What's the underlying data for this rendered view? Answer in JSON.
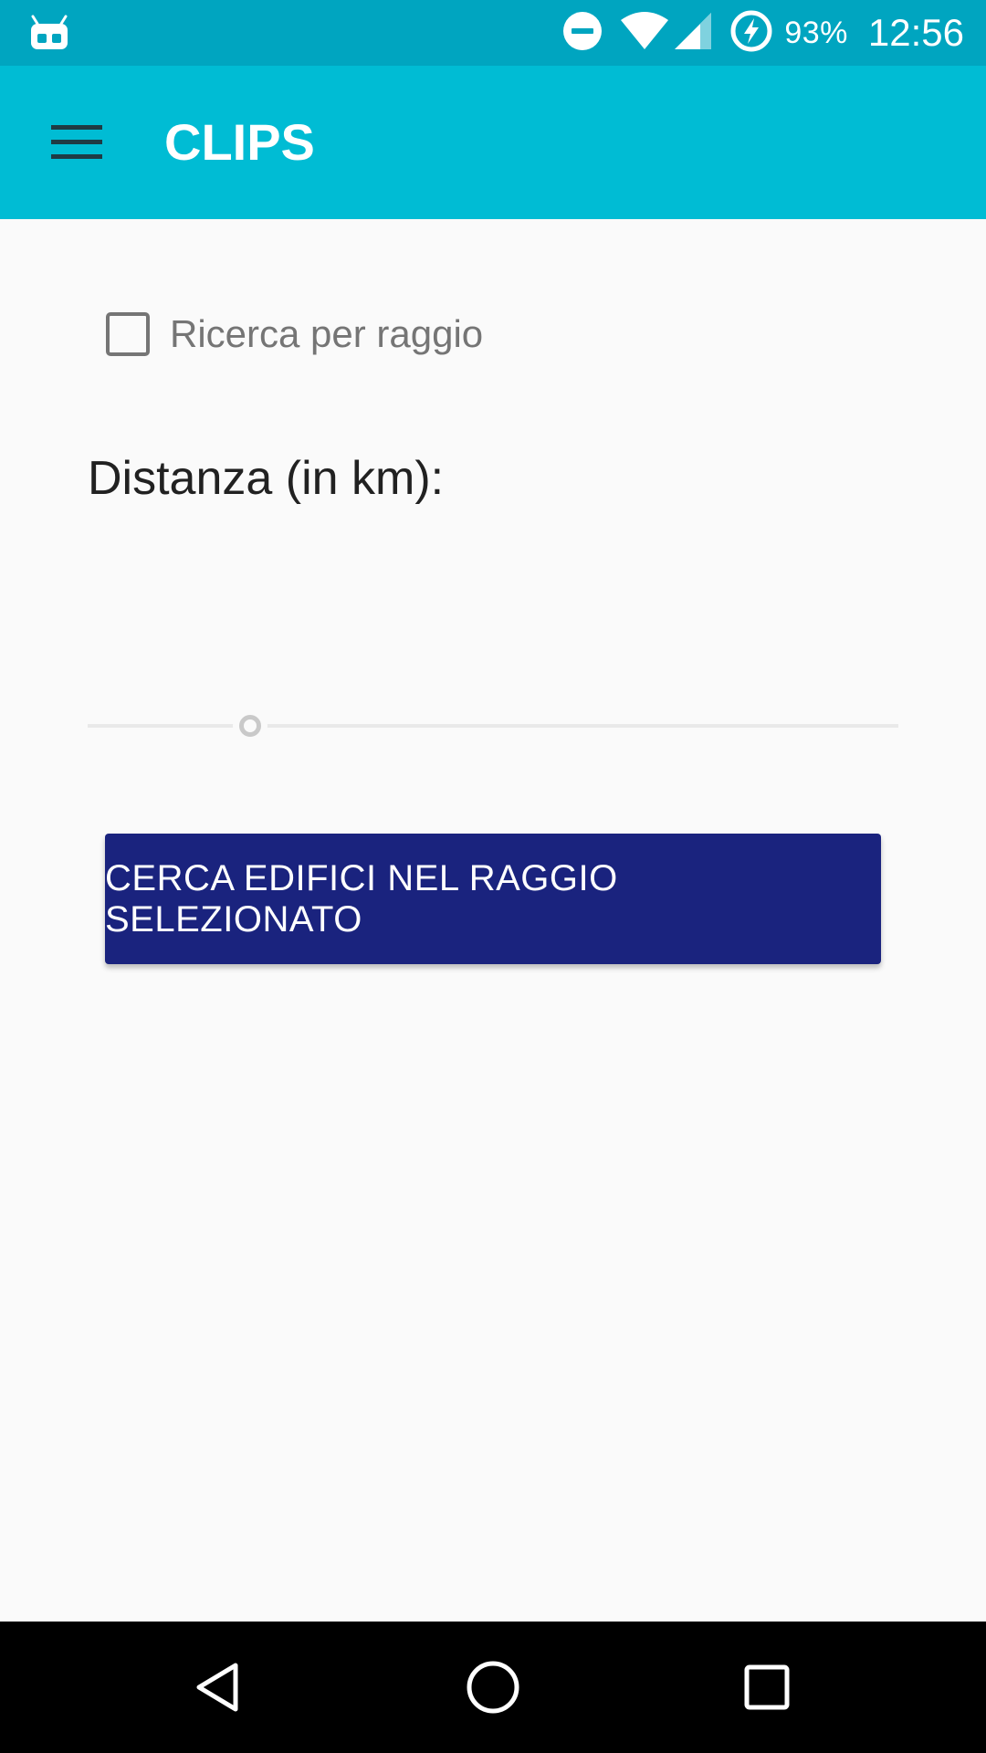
{
  "status_bar": {
    "time": "12:56",
    "battery_percent": "93%",
    "icons": [
      "android-debug-icon",
      "do-not-disturb-icon",
      "wifi-icon",
      "cell-signal-icon",
      "battery-charging-icon"
    ]
  },
  "app_bar": {
    "title": "CLIPS",
    "menu_icon": "hamburger-menu-icon",
    "background": "#00bcd4"
  },
  "form": {
    "radius_checkbox": {
      "label": "Ricerca per raggio",
      "checked": false
    },
    "distance_label": "Distanza (in km):",
    "slider": {
      "value_fraction": 0.2,
      "enabled": false
    },
    "search_button": {
      "label": "CERCA EDIFICI NEL RAGGIO SELEZIONATO",
      "color": "#1a237e"
    }
  },
  "nav_bar": {
    "buttons": [
      "back-icon",
      "home-icon",
      "recents-icon"
    ]
  }
}
